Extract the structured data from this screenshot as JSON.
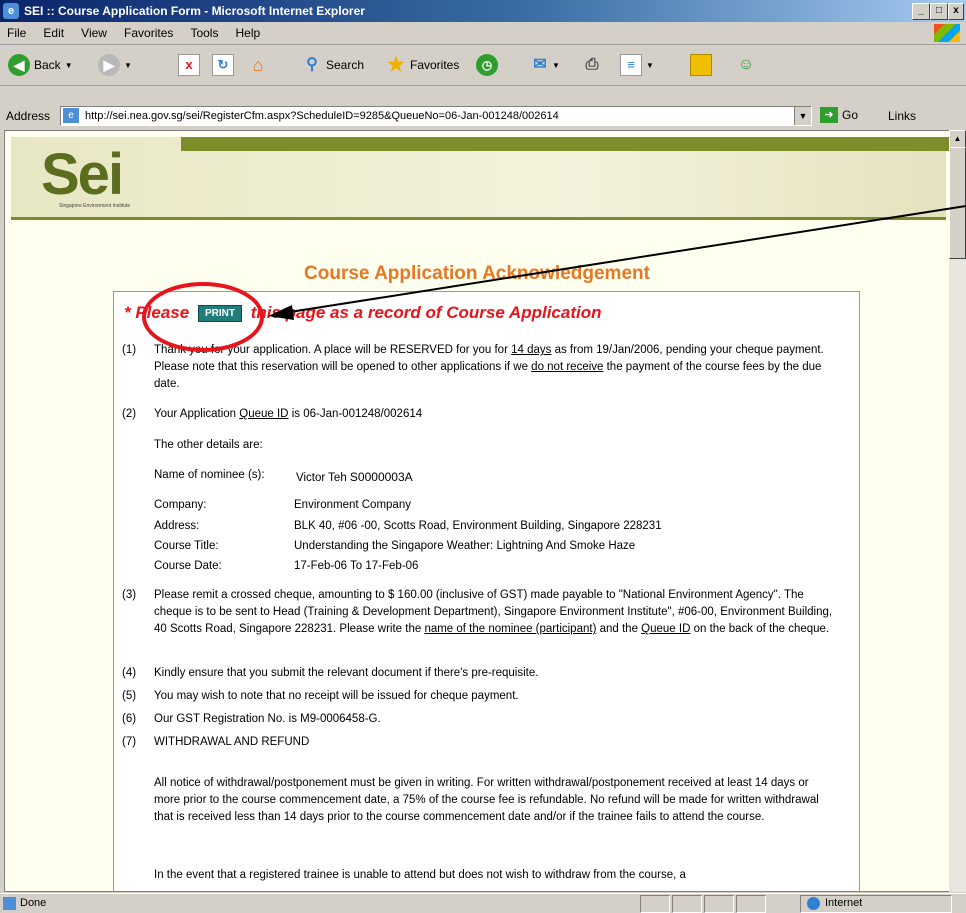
{
  "window": {
    "title": "SEI :: Course Application Form - Microsoft Internet Explorer"
  },
  "menu": [
    "File",
    "Edit",
    "View",
    "Favorites",
    "Tools",
    "Help"
  ],
  "toolbar": {
    "back": "Back",
    "search": "Search",
    "favorites": "Favorites"
  },
  "address": {
    "label": "Address",
    "url": "http://sei.nea.gov.sg/sei/RegisterCfm.aspx?ScheduleID=9285&QueueNo=06-Jan-001248/002614",
    "go": "Go",
    "links": "Links"
  },
  "banner": {
    "logo": "Sei",
    "subtitle": "Singapore Environment Institute"
  },
  "page": {
    "heading": "Course Application Acknowledgement",
    "please_pre": "* Please",
    "print_label": "PRINT",
    "please_post": "this page as a record of Course Application"
  },
  "items": {
    "i1": {
      "num": "(1)",
      "a": "Thank you for your application. A place will be RESERVED for you for ",
      "b": "14 days",
      "c": " as from 19/Jan/2006, pending your cheque payment. Please note that this reservation will be opened to other applications if we ",
      "d": "do not receive",
      "e": " the payment of the course fees by the due date."
    },
    "i2": {
      "num": "(2)",
      "a": "Your Application ",
      "b": "Queue ID",
      "c": " is 06-Jan-001248/002614",
      "other": "The other details are:"
    },
    "nominee": {
      "label": "Name of nominee (s):",
      "name": "Victor Teh",
      "nric": "S0000003A"
    },
    "details": [
      {
        "label": "Company:",
        "value": "Environment Company"
      },
      {
        "label": "Address:",
        "value": "BLK 40, #06 -00, Scotts Road, Environment Building, Singapore 228231"
      },
      {
        "label": "Course Title:",
        "value": "Understanding the Singapore Weather: Lightning And Smoke Haze"
      },
      {
        "label": "Course Date:",
        "value": "17-Feb-06 To 17-Feb-06"
      }
    ],
    "i3": {
      "num": "(3)",
      "a": "Please remit a crossed cheque, amounting to $ 160.00 (inclusive of GST) made payable to \"National Environment Agency\". The cheque is to be sent to Head (Training & Development Department), Singapore Environment Institute\", #06-00, Environment Building, 40 Scotts Road, Singapore 228231. Please write the ",
      "b": "name of the nominee (participant)",
      "c": " and the ",
      "d": "Queue ID",
      "e": " on the back of the cheque."
    },
    "i4": {
      "num": "(4)",
      "text": "Kindly ensure that you submit the relevant document if there's pre-requisite."
    },
    "i5": {
      "num": "(5)",
      "text": "You may wish to note that no receipt will be issued for cheque payment."
    },
    "i6": {
      "num": "(6)",
      "text": "Our GST Registration No. is M9-0006458-G."
    },
    "i7": {
      "num": "(7)",
      "text": "WITHDRAWAL AND REFUND"
    },
    "withdrawal": "All notice of withdrawal/postponement must be given in writing. For written withdrawal/postponement received at least 14 days or more prior to the course commencement date, a 75% of the course fee is refundable. No refund will be made for written withdrawal that is received less than 14 days prior to the course commencement date and/or if the trainee fails to attend the course.",
    "cutoff": "In the event that a registered trainee is unable to attend but does not wish to withdraw from the course, a"
  },
  "status": {
    "left": "Done",
    "zone": "Internet"
  }
}
